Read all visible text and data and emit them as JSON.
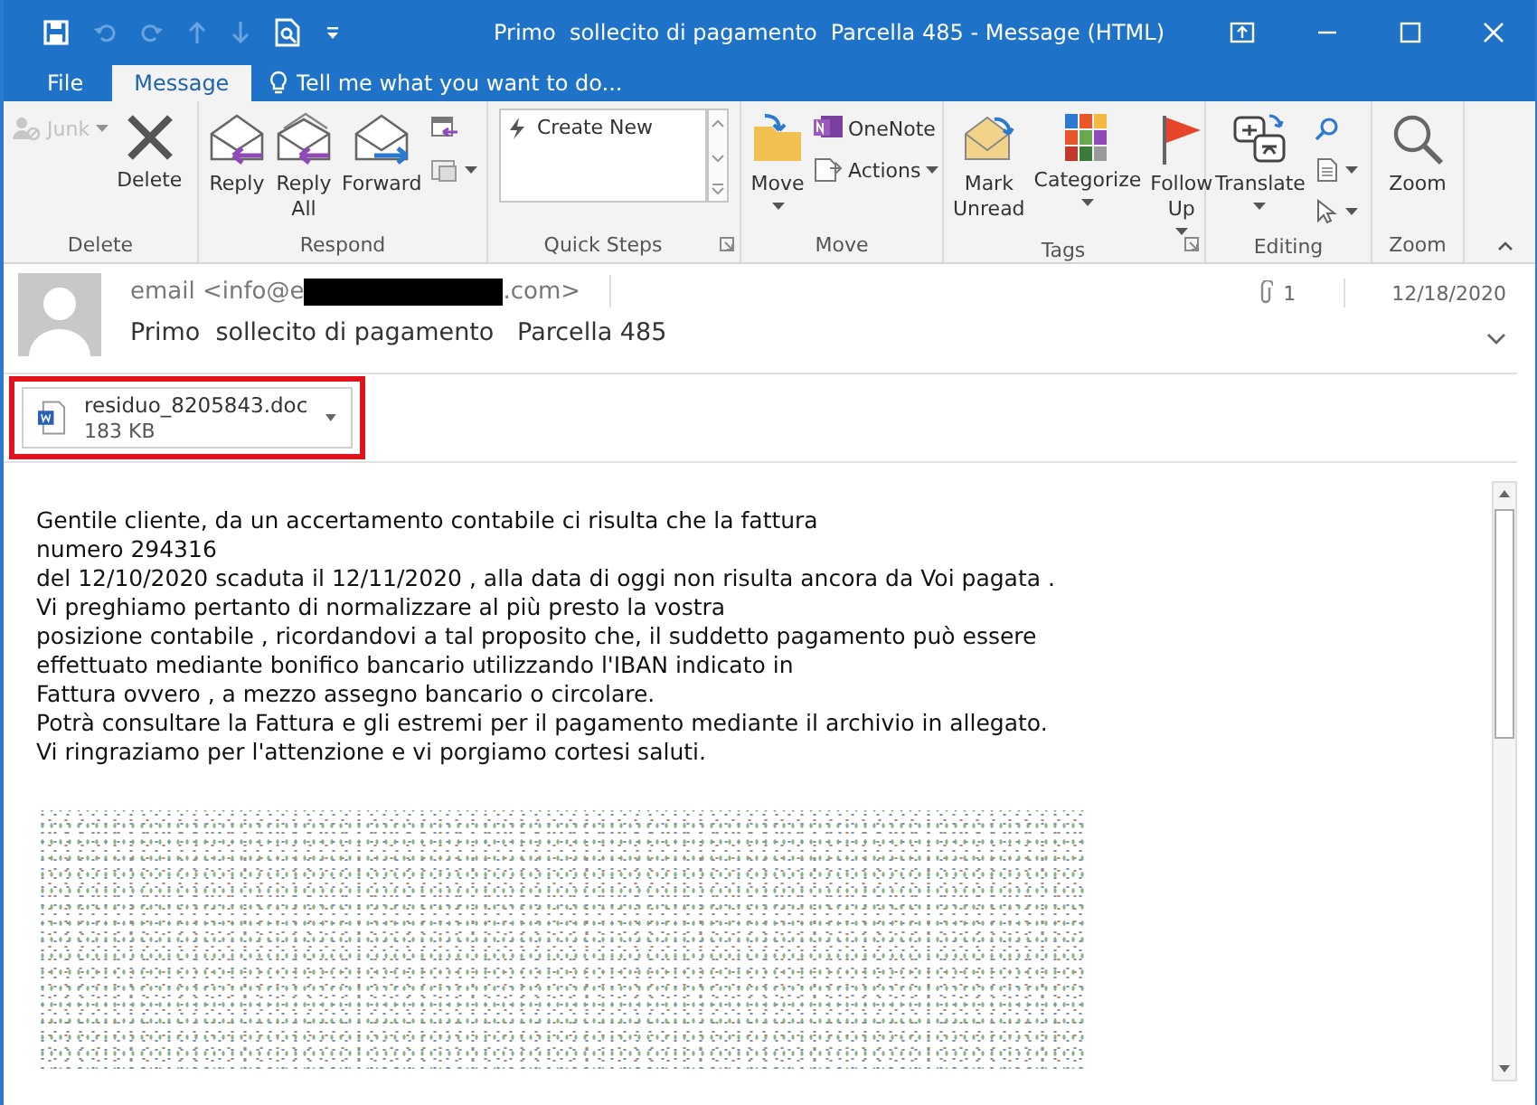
{
  "window": {
    "title": "Primo  sollecito di pagamento  Parcella 485 - Message (HTML)"
  },
  "tabs": [
    {
      "label": "File",
      "selected": false
    },
    {
      "label": "Message",
      "selected": true
    }
  ],
  "tell_me": {
    "placeholder": "Tell me what you want to do..."
  },
  "ribbon_groups": [
    {
      "label": "Delete",
      "launcher": false,
      "items": [
        {
          "kind": "small_menu",
          "label": "Junk",
          "disabled": true
        },
        {
          "kind": "large",
          "label": "Delete",
          "disabled": false
        }
      ]
    },
    {
      "label": "Respond",
      "launcher": false,
      "items": [
        {
          "kind": "large",
          "label": "Reply",
          "disabled": false
        },
        {
          "kind": "large",
          "label": "Reply All",
          "disabled": false
        },
        {
          "kind": "large",
          "label": "Forward",
          "disabled": false
        },
        {
          "kind": "small",
          "disabled": false
        },
        {
          "kind": "small_menu",
          "disabled": false
        }
      ]
    },
    {
      "label": "Quick Steps",
      "launcher": true,
      "items": [
        {
          "kind": "gallery",
          "label": "Create New",
          "disabled": false
        }
      ]
    },
    {
      "label": "Move",
      "launcher": false,
      "items": [
        {
          "kind": "large_menu",
          "label": "Move",
          "disabled": false
        },
        {
          "kind": "small",
          "label": "OneNote",
          "disabled": false
        },
        {
          "kind": "small_menu",
          "label": "Actions",
          "disabled": false
        }
      ]
    },
    {
      "label": "Tags",
      "launcher": true,
      "items": [
        {
          "kind": "large",
          "label": "Mark Unread",
          "disabled": false
        },
        {
          "kind": "large_menu",
          "label": "Categorize",
          "disabled": false
        },
        {
          "kind": "large_menu",
          "label": "Follow Up",
          "disabled": false
        }
      ]
    },
    {
      "label": "Editing",
      "launcher": false,
      "items": [
        {
          "kind": "large_menu",
          "label": "Translate",
          "disabled": false
        },
        {
          "kind": "small",
          "disabled": false
        },
        {
          "kind": "small_menu",
          "disabled": false
        },
        {
          "kind": "small_menu",
          "disabled": false
        }
      ]
    },
    {
      "label": "Zoom",
      "launcher": false,
      "items": [
        {
          "kind": "large",
          "label": "Zoom",
          "disabled": false
        }
      ]
    }
  ],
  "message": {
    "sender_start": "email <info@e",
    "sender_end": ".com>",
    "attachment_count": "1",
    "date": "12/18/2020",
    "subject": "Primo  sollecito di pagamento   Parcella 485"
  },
  "attachment": {
    "name": "residuo_8205843.doc",
    "size": "183 KB",
    "highlighted": true
  },
  "body": {
    "lines": [
      "Gentile cliente, da un accertamento contabile ci risulta che la fattura",
      "numero 294316",
      "del 12/10/2020 scaduta il 12/11/2020 , alla data di oggi non risulta ancora da Voi pagata .",
      "Vi preghiamo pertanto di normalizzare al più presto la vostra",
      "posizione contabile , ricordandovi a tal proposito che, il suddetto pagamento può essere",
      "effettuato mediante bonifico bancario utilizzando l'IBAN indicato in",
      "Fattura ovvero , a mezzo assegno bancario o circolare.",
      "Potrà consultare la Fattura e gli estremi per il pagamento mediante il archivio in allegato.",
      "Vi ringraziamo per l'attenzione e vi porgiamo cortesi saluti."
    ]
  }
}
